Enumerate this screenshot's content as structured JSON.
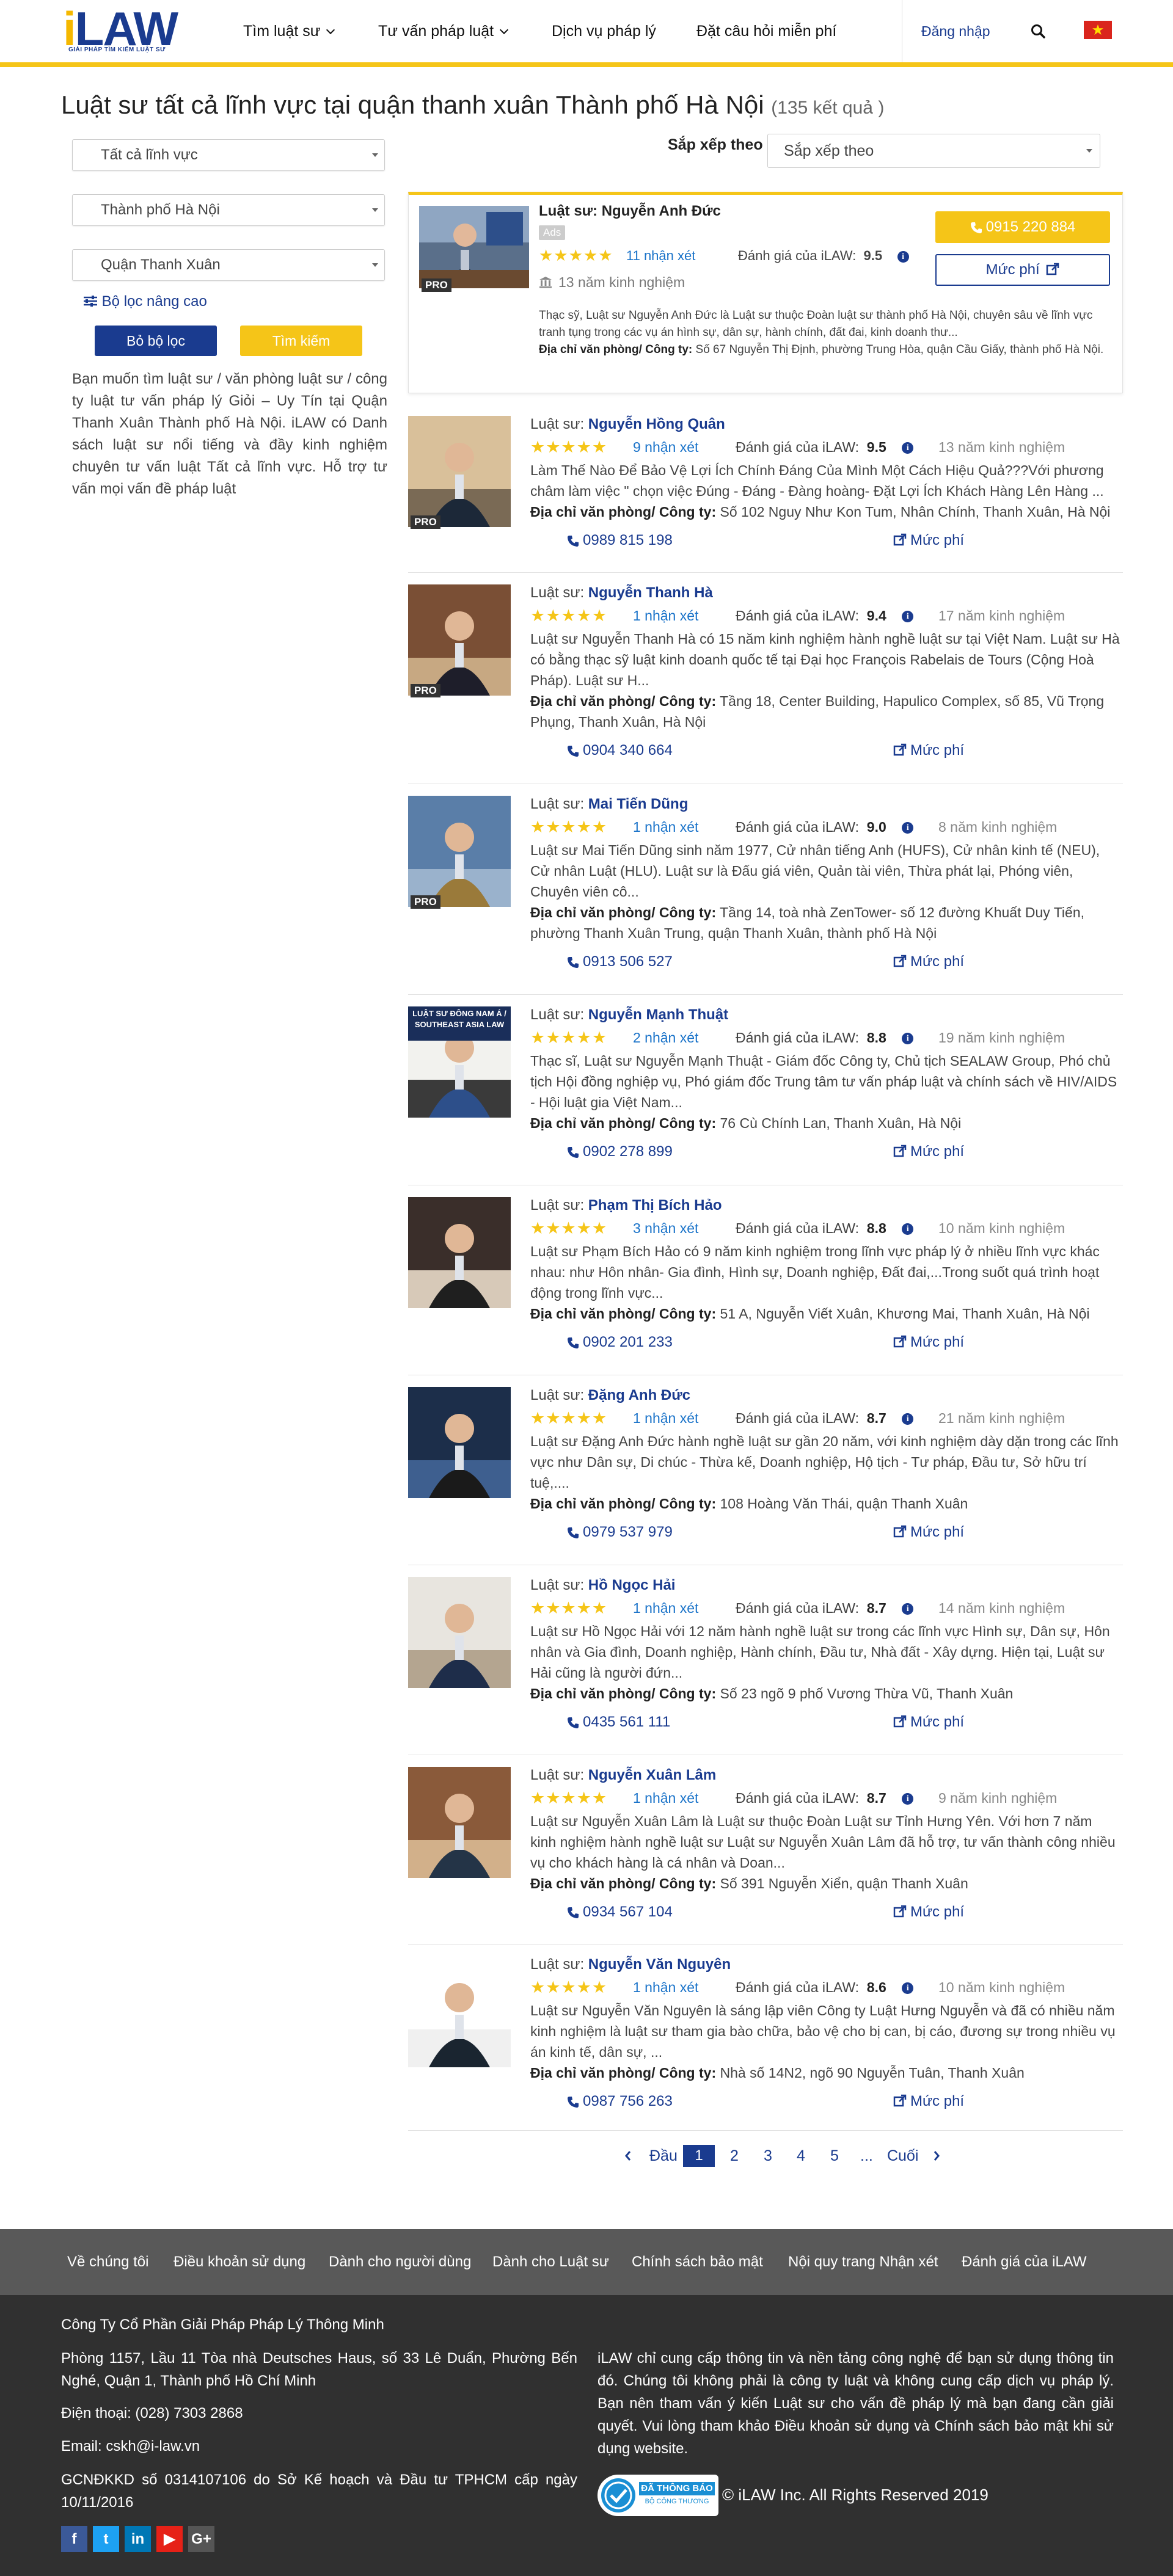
{
  "header": {
    "logo_text_i": "i",
    "logo_text_rest": "LAW",
    "logo_tagline": "GIẢI PHÁP TÌM KIẾM LUẬT SƯ",
    "nav": [
      "Tìm luật sư",
      "Tư vấn pháp luật",
      "Dịch vụ pháp lý",
      "Đặt câu hỏi miễn phí"
    ],
    "login": "Đăng nhập",
    "colors": {
      "brand": "#1a3b8f",
      "accent": "#f5c518",
      "flag": "#da251d"
    }
  },
  "page": {
    "title": "Luật sư tất cả lĩnh vực tại quận thanh xuân Thành phố Hà Nội",
    "result_count": "(135 kết quả )"
  },
  "filters": {
    "field": "Tất cả lĩnh vực",
    "city": "Thành phố Hà Nội",
    "district": "Quận Thanh Xuân",
    "advanced": "Bộ lọc nâng cao",
    "clear_button": "Bỏ bộ lọc",
    "search_button": "Tìm kiếm",
    "intro": "Bạn muốn tìm luật sư / văn phòng luật sư / công ty luật tư vấn pháp lý Giỏi – Uy Tín tại Quận Thanh Xuân Thành phố Hà Nội. iLAW có Danh sách luật sư nổi tiếng và đầy kinh nghiệm chuyên tư vấn luật Tất cả lĩnh vực. Hỗ trợ tư vấn mọi vấn đề pháp luật"
  },
  "sort": {
    "label": "Sắp xếp theo",
    "value": "Sắp xếp theo"
  },
  "featured": {
    "prefix": "Luật sư:",
    "name": "Nguyễn Anh Đức",
    "ads": "Ads",
    "reviews": "11 nhận xét",
    "rating_label": "Đánh giá của iLAW:",
    "rating": "9.5",
    "experience": "13 năm kinh nghiệm",
    "desc": "Thạc sỹ, Luật sư Nguyễn Anh Đức là Luật sư thuộc Đoàn luật sư thành phố Hà Nội, chuyên sâu về lĩnh vực tranh tụng trong các vụ án hình sự, dân sự, hành chính, đất đai, kinh doanh thư...",
    "addr_label": "Địa chỉ văn phòng/ Công ty:",
    "addr": "Số 67 Nguyễn Thị Định, phường Trung Hòa, quận Cầu Giấy, thành phố Hà Nội.",
    "phone": "0915 220 884",
    "fee": "Mức phí",
    "pro": "PRO"
  },
  "labels": {
    "prefix": "Luật sư:",
    "rating_label": "Đánh giá của iLAW:",
    "addr_label": "Địa chỉ văn phòng/ Công ty:",
    "fee": "Mức phí",
    "pro": "PRO"
  },
  "lawyers": [
    {
      "name": "Nguyễn Hồng Quân",
      "reviews": "9 nhận xét",
      "rating": "9.5",
      "experience": "13 năm kinh nghiệm",
      "pro": true,
      "desc": "Làm Thế Nào Để Bảo Vệ Lợi Ích Chính Đáng Của Mình Một Cách Hiệu Quả???Với phương châm làm việc \" chọn việc Đúng - Đáng - Đàng hoàng- Đặt Lợi Ích Khách Hàng Lên Hàng ...",
      "addr": "Số 102 Nguy Như Kon Tum, Nhân Chính, Thanh Xuân, Hà Nội",
      "phone": "0989 815 198"
    },
    {
      "name": "Nguyễn Thanh Hà",
      "reviews": "1 nhận xét",
      "rating": "9.4",
      "experience": "17 năm kinh nghiệm",
      "pro": true,
      "desc": "Luật sư Nguyễn Thanh Hà có 15 năm kinh nghiệm hành nghề luật sư tại Việt Nam. Luật sư Hà có bằng thạc sỹ luật kinh doanh quốc tế tại Đại học François Rabelais de Tours (Cộng Hoà Pháp). Luật sư H...",
      "addr": "Tầng 18, Center Building, Hapulico Complex, số 85, Vũ Trọng Phụng, Thanh Xuân, Hà Nội",
      "phone": "0904 340 664"
    },
    {
      "name": "Mai Tiến Dũng",
      "reviews": "1 nhận xét",
      "rating": "9.0",
      "experience": "8 năm kinh nghiệm",
      "pro": true,
      "desc": "Luật sư Mai Tiến Dũng sinh năm 1977, Cử nhân tiếng Anh (HUFS), Cử nhân kinh tế (NEU), Cử nhân Luật (HLU). Luật sư là Đấu giá viên, Quản tài viên, Thừa phát lại, Phóng viên, Chuyên viên cô...",
      "addr": "Tầng 14, toà nhà ZenTower- số 12 đường Khuất Duy Tiến, phường Thanh Xuân Trung, quận Thanh Xuân, thành phố Hà Nội",
      "phone": "0913 506 527"
    },
    {
      "name": "Nguyễn Mạnh Thuật",
      "reviews": "2 nhận xét",
      "rating": "8.8",
      "experience": "19 năm kinh nghiệm",
      "pro": false,
      "photo_text": "LUẬT SƯ ĐÔNG NAM Á / SOUTHEAST ASIA LAW",
      "desc": "Thạc sĩ, Luật sư Nguyễn Mạnh Thuật - Giám đốc Công ty, Chủ tịch SEALAW Group, Phó chủ tịch Hội đồng nghiệp vụ, Phó giám đốc Trung tâm tư vấn pháp luật và chính sách về HIV/AIDS - Hội luật gia Việt Nam...",
      "addr": "76 Cù Chính Lan, Thanh Xuân, Hà Nội",
      "phone": "0902 278 899"
    },
    {
      "name": "Phạm Thị Bích Hảo",
      "reviews": "3 nhận xét",
      "rating": "8.8",
      "experience": "10 năm kinh nghiệm",
      "pro": false,
      "desc": "Luật sư Phạm Bích Hảo có 9 năm kinh nghiệm trong lĩnh vực pháp lý ở nhiều lĩnh vực khác nhau: như Hôn nhân- Gia đình, Hình sự, Doanh nghiệp, Đất đai,...Trong suốt quá trình hoạt động trong lĩnh vực...",
      "addr": "51 A, Nguyễn Viết Xuân, Khương Mai, Thanh Xuân, Hà Nội",
      "phone": "0902 201 233"
    },
    {
      "name": "Đặng Anh Đức",
      "reviews": "1 nhận xét",
      "rating": "8.7",
      "experience": "21 năm kinh nghiệm",
      "pro": false,
      "desc": "Luật sư Đặng Anh Đức hành nghề luật sư gần 20 năm, với kinh nghiệm dày dặn trong các lĩnh vực như Dân sự, Di chúc - Thừa kế, Doanh nghiệp, Hộ tịch - Tư pháp, Đầu tư, Sở hữu trí tuệ,....",
      "addr": "108 Hoàng Văn Thái, quận Thanh Xuân",
      "phone": "0979 537 979"
    },
    {
      "name": "Hồ Ngọc Hải",
      "reviews": "1 nhận xét",
      "rating": "8.7",
      "experience": "14 năm kinh nghiệm",
      "pro": false,
      "desc": "Luật sư Hồ Ngọc Hải với 12 năm hành nghề luật sư trong các lĩnh vực Hình sự, Dân sự, Hôn nhân và Gia đình, Doanh nghiệp, Hành chính, Đầu tư, Nhà đất - Xây dựng. Hiện tại, Luật sư Hải cũng là người đứn...",
      "addr": "Số 23 ngõ 9 phố Vương Thừa Vũ, Thanh Xuân",
      "phone": "0435 561 111"
    },
    {
      "name": "Nguyễn Xuân Lâm",
      "reviews": "1 nhận xét",
      "rating": "8.7",
      "experience": "9 năm kinh nghiệm",
      "pro": false,
      "desc": "Luật sư Nguyễn Xuân Lâm là Luật sư thuộc Đoàn Luật sư Tỉnh Hưng Yên. Với hơn 7 năm kinh nghiệm hành nghề luật sư Luật sư Nguyễn Xuân Lâm đã hỗ trợ, tư vấn thành công nhiều vụ cho khách hàng là cá nhân và Doan...",
      "addr": "Số 391 Nguyễn Xiển, quận Thanh Xuân",
      "phone": "0934 567 104"
    },
    {
      "name": "Nguyễn Văn Nguyên",
      "reviews": "1 nhận xét",
      "rating": "8.6",
      "experience": "10 năm kinh nghiệm",
      "pro": false,
      "desc": "Luật sư Nguyễn Văn Nguyên là sáng lập viên Công ty Luật Hưng Nguyễn và đã có nhiều năm kinh nghiệm là luật sư tham gia bào chữa, bảo vệ cho bị can, bị cáo, đương sự trong nhiều vụ án kinh tế, dân sự, ...",
      "addr": "Nhà số 14N2, ngõ 90 Nguyễn Tuân, Thanh Xuân",
      "phone": "0987 756 263"
    }
  ],
  "pagination": {
    "first": "Đầu",
    "pages": [
      "1",
      "2",
      "3",
      "4",
      "5"
    ],
    "ellipsis": "...",
    "last": "Cuối",
    "current": "1"
  },
  "footer_nav": [
    "Về chúng tôi",
    "Điều khoản sử dụng",
    "Dành cho người dùng",
    "Dành cho Luật sư",
    "Chính sách bảo mật",
    "Nội quy trang Nhận xét",
    "Đánh giá của iLAW"
  ],
  "footer": {
    "company": "Công Ty Cổ Phần Giải Pháp Pháp Lý Thông Minh",
    "address": "Phòng 1157, Lầu 11 Tòa nhà Deutsches Haus, số 33 Lê Duẩn, Phường Bến Nghé, Quận 1, Thành phố Hồ Chí Minh",
    "phone": "Điện thoại: (028) 7303 2868",
    "email": "Email: cskh@i-law.vn",
    "license": "GCNĐKKD số 0314107106 do Sở Kế hoạch và Đầu tư TPHCM cấp ngày 10/11/2016",
    "disclaimer": "iLAW chỉ cung cấp thông tin và nền tảng công nghệ để bạn sử dụng thông tin đó. Chúng tôi không phải là công ty luật và không cung cấp dịch vụ pháp lý. Bạn nên tham vấn ý kiến Luật sư cho vấn đề pháp lý mà bạn đang cần giải quyết. Vui lòng tham khảo Điều khoản sử dụng và Chính sách bảo mật khi sử dụng website.",
    "badge_line1": "ĐÃ THÔNG BÁO",
    "badge_line2": "BỘ CÔNG THƯƠNG",
    "copyright": "© iLAW Inc. All Rights Reserved 2019",
    "social": [
      {
        "icon": "facebook-icon",
        "glyph": "f",
        "color": "#3b5998"
      },
      {
        "icon": "twitter-icon",
        "glyph": "t",
        "color": "#1da1f2"
      },
      {
        "icon": "linkedin-icon",
        "glyph": "in",
        "color": "#0077b5"
      },
      {
        "icon": "youtube-icon",
        "glyph": "▶",
        "color": "#e62117"
      },
      {
        "icon": "google-plus-icon",
        "glyph": "G+",
        "color": "#555555"
      }
    ]
  }
}
